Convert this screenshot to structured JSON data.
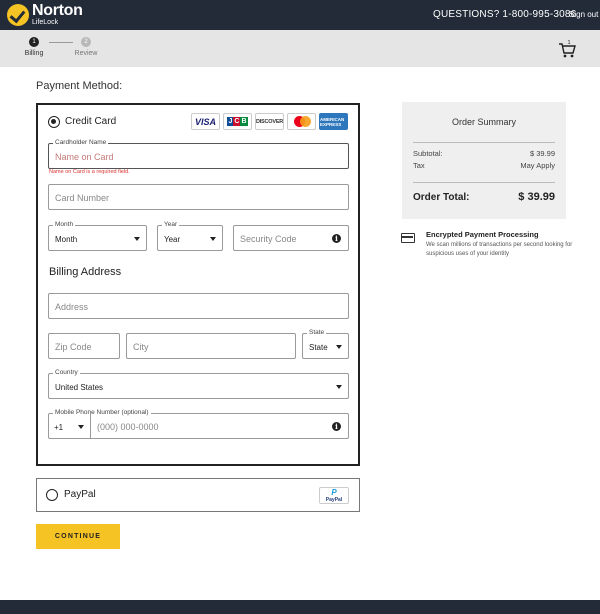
{
  "header": {
    "brand": "Norton",
    "brand_sub": "LifeLock",
    "phone": "QUESTIONS? 1-800-995-3086",
    "signout": "Sign out"
  },
  "steps": [
    {
      "num": "1",
      "label": "Billing",
      "active": true
    },
    {
      "num": "2",
      "label": "Review",
      "active": false
    }
  ],
  "payment_method_title": "Payment Method:",
  "credit_card": {
    "label": "Credit Card",
    "selected": true,
    "card_logos": [
      "VISA",
      "JCB",
      "DISCOVER",
      "MASTERCARD",
      "AMERICAN EXPRESS"
    ]
  },
  "form": {
    "cardholder_label": "Cardholder Name",
    "cardholder_placeholder": "Name on Card",
    "cardholder_error": "Name on Card is a required field.",
    "card_number_placeholder": "Card Number",
    "month_label": "Month",
    "month_value": "Month",
    "year_label": "Year",
    "year_value": "Year",
    "security_placeholder": "Security Code",
    "billing_title": "Billing Address",
    "address_placeholder": "Address",
    "zip_placeholder": "Zip Code",
    "city_placeholder": "City",
    "state_label": "State",
    "state_value": "State",
    "country_label": "Country",
    "country_value": "United States",
    "phone_label": "Mobile Phone Number (optional)",
    "phone_code": "+1",
    "phone_placeholder": "(000) 000-0000"
  },
  "paypal": {
    "label": "PayPal",
    "logo_text": "PayPal",
    "logo_letter": "P"
  },
  "continue_label": "CONTINUE",
  "summary": {
    "title": "Order Summary",
    "subtotal_label": "Subtotal:",
    "subtotal_value": "$ 39.99",
    "tax_label": "Tax",
    "tax_value": "May Apply",
    "total_label": "Order Total:",
    "total_value": "$ 39.99"
  },
  "encryption": {
    "title": "Encrypted Payment Processing",
    "desc": "We scan millions of transactions per second looking for suspicious uses of your identity"
  },
  "colors": {
    "header_bg": "#232b38",
    "accent_yellow": "#f6c324",
    "error_red": "#d33333",
    "summary_bg": "#efefef"
  },
  "icons": [
    "norton-check-icon",
    "cart-icon",
    "info-icon",
    "credit-card-icon",
    "caret-down-icon"
  ]
}
